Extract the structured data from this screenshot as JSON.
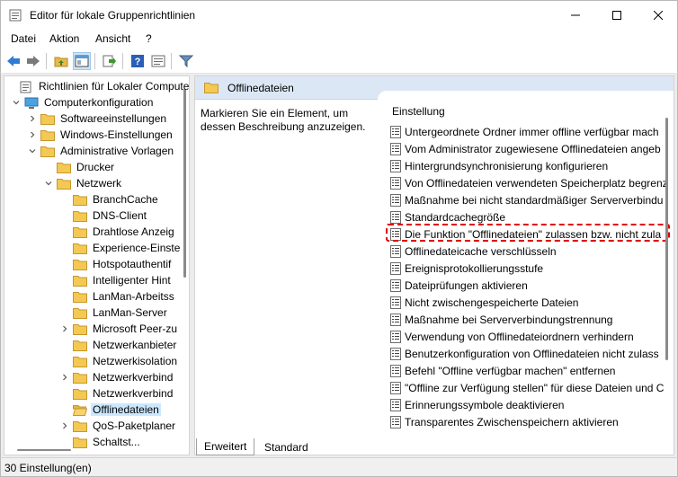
{
  "window": {
    "title": "Editor für lokale Gruppenrichtlinien"
  },
  "menu": [
    "Datei",
    "Aktion",
    "Ansicht",
    "?"
  ],
  "tree": [
    {
      "label": "Richtlinien für Lokaler Compute",
      "indent": 0,
      "expander": "",
      "icon": "policy-icon"
    },
    {
      "label": "Computerkonfiguration",
      "indent": 1,
      "expander": "open",
      "icon": "computer-icon"
    },
    {
      "label": "Softwareeinstellungen",
      "indent": 2,
      "expander": "closed",
      "icon": "folder-icon"
    },
    {
      "label": "Windows-Einstellungen",
      "indent": 2,
      "expander": "closed",
      "icon": "folder-icon"
    },
    {
      "label": "Administrative Vorlagen",
      "indent": 2,
      "expander": "open",
      "icon": "folder-icon"
    },
    {
      "label": "Drucker",
      "indent": 3,
      "expander": "",
      "icon": "folder-icon"
    },
    {
      "label": "Netzwerk",
      "indent": 3,
      "expander": "open",
      "icon": "folder-icon"
    },
    {
      "label": "BranchCache",
      "indent": 4,
      "expander": "",
      "icon": "folder-icon"
    },
    {
      "label": "DNS-Client",
      "indent": 4,
      "expander": "",
      "icon": "folder-icon"
    },
    {
      "label": "Drahtlose Anzeig",
      "indent": 4,
      "expander": "",
      "icon": "folder-icon"
    },
    {
      "label": "Experience-Einste",
      "indent": 4,
      "expander": "",
      "icon": "folder-icon"
    },
    {
      "label": "Hotspotauthentif",
      "indent": 4,
      "expander": "",
      "icon": "folder-icon"
    },
    {
      "label": "Intelligenter Hint",
      "indent": 4,
      "expander": "",
      "icon": "folder-icon"
    },
    {
      "label": "LanMan-Arbeitss",
      "indent": 4,
      "expander": "",
      "icon": "folder-icon"
    },
    {
      "label": "LanMan-Server",
      "indent": 4,
      "expander": "",
      "icon": "folder-icon"
    },
    {
      "label": "Microsoft Peer-zu",
      "indent": 4,
      "expander": "closed",
      "icon": "folder-icon"
    },
    {
      "label": "Netzwerkanbieter",
      "indent": 4,
      "expander": "",
      "icon": "folder-icon"
    },
    {
      "label": "Netzwerkisolation",
      "indent": 4,
      "expander": "",
      "icon": "folder-icon"
    },
    {
      "label": "Netzwerkverbind",
      "indent": 4,
      "expander": "closed",
      "icon": "folder-icon"
    },
    {
      "label": "Netzwerkverbind",
      "indent": 4,
      "expander": "",
      "icon": "folder-icon"
    },
    {
      "label": "Offlinedateien",
      "indent": 4,
      "expander": "",
      "icon": "folder-open-icon",
      "selected": true
    },
    {
      "label": "QoS-Paketplaner",
      "indent": 4,
      "expander": "closed",
      "icon": "folder-icon"
    },
    {
      "label": "Schaltst...",
      "indent": 4,
      "expander": "",
      "icon": "folder-icon"
    }
  ],
  "right": {
    "header": "Offlinedateien",
    "description": "Markieren Sie ein Element, um dessen Beschreibung anzuzeigen.",
    "column_header": "Einstellung",
    "settings": [
      "Untergeordnete Ordner immer offline verfügbar mach",
      "Vom Administrator zugewiesene Offlinedateien angeb",
      "Hintergrundsynchronisierung konfigurieren",
      "Von Offlinedateien verwendeten Speicherplatz begrenz",
      "Maßnahme bei nicht standardmäßiger Serververbindu",
      "Standardcachegröße",
      "Die Funktion \"Offlinedateien\" zulassen bzw. nicht zula",
      "Offlinedateicache verschlüsseln",
      "Ereignisprotokollierungsstufe",
      "Dateiprüfungen aktivieren",
      "Nicht zwischengespeicherte Dateien",
      "Maßnahme bei Serververbindungstrennung",
      "Verwendung von Offlinedateiordnern verhindern",
      "Benutzerkonfiguration von Offlinedateien nicht zulass",
      "Befehl \"Offline verfügbar machen\" entfernen",
      "\"Offline zur Verfügung stellen\" für diese Dateien und C",
      "Erinnerungssymbole deaktivieren",
      "Transparentes Zwischenspeichern aktivieren"
    ],
    "highlighted_index": 6
  },
  "tabs": [
    "Erweitert",
    "Standard"
  ],
  "active_tab": "Erweitert",
  "status": "30 Einstellung(en)"
}
